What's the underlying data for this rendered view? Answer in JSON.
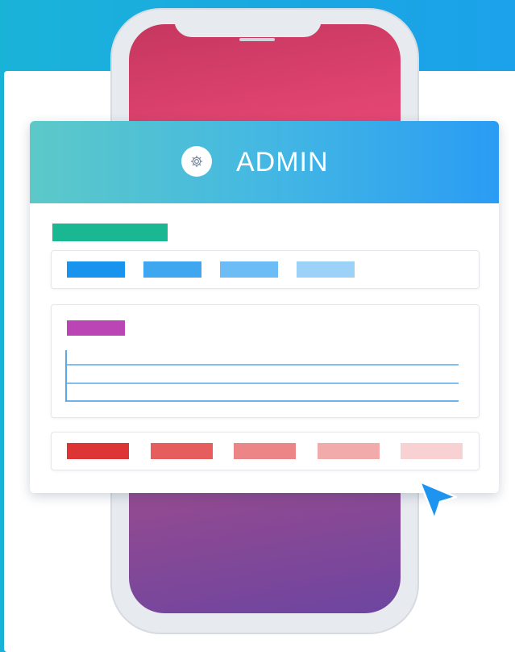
{
  "admin_window": {
    "title": "ADMIN",
    "icon": "gear-icon"
  },
  "colors": {
    "header_gradient": [
      "#5cc9c8",
      "#2a9cf4"
    ],
    "section_heading": "#19b892",
    "blue_chips": [
      "#1994ee",
      "#3ea7f0",
      "#6cbcf5",
      "#9dd2f8"
    ],
    "list_heading": "#bb45b4",
    "list_lines": "#5aa8e6",
    "red_chips": [
      "#dd3535",
      "#e55d5d",
      "#ec8686",
      "#f2abab",
      "#f8d2d2"
    ],
    "cursor": "#1d95f0"
  },
  "decor": {
    "device": "smartphone",
    "cursor_icon": "pointer-cursor-icon"
  }
}
